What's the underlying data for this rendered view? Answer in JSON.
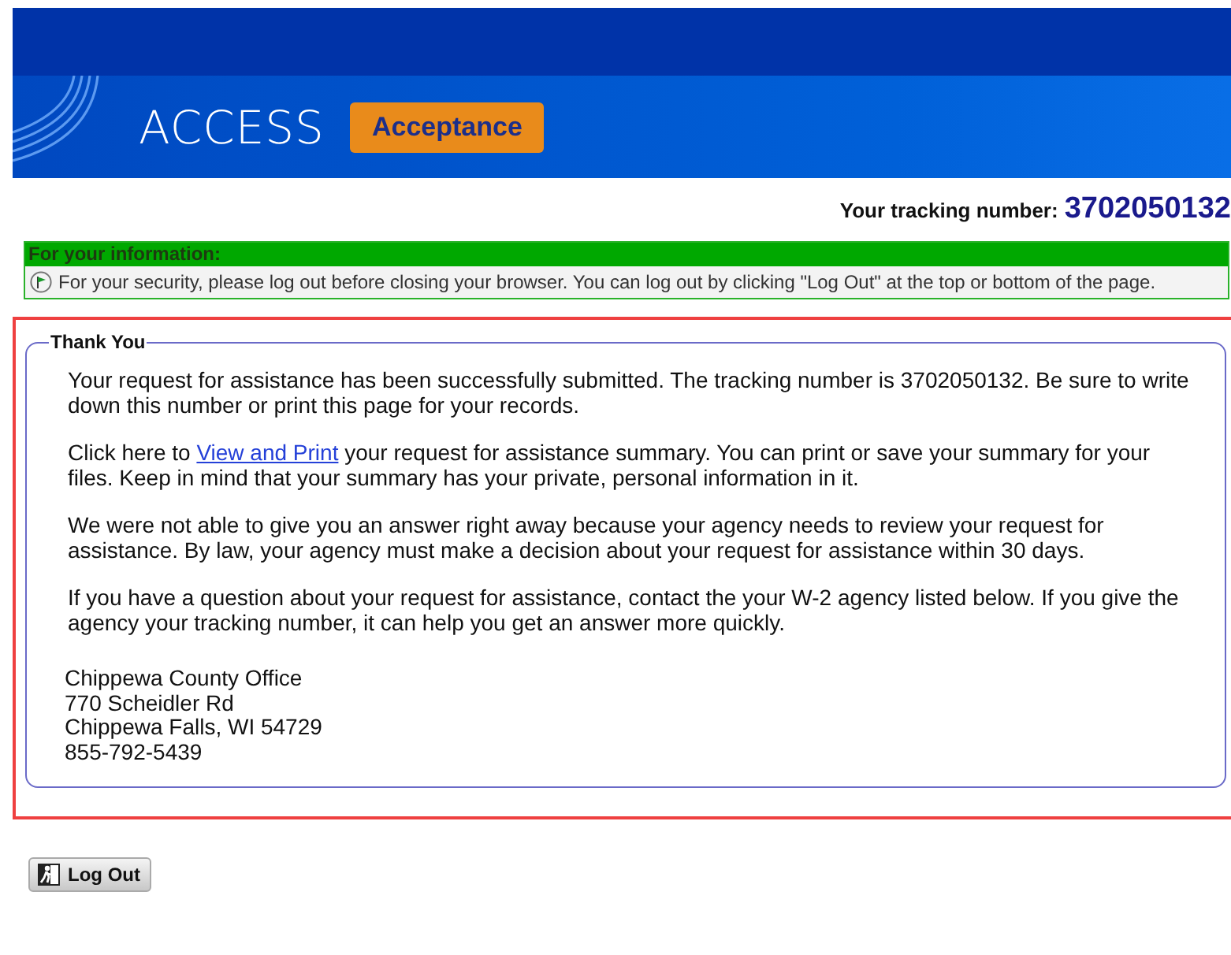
{
  "header": {
    "logo": "ACCESS",
    "badge": "Acceptance"
  },
  "tracking": {
    "label": "Your tracking number:",
    "number": "3702050132"
  },
  "info": {
    "title": "For your information:",
    "message": "For your security, please log out before closing your browser. You can log out by clicking \"Log Out\" at the top or bottom of the page."
  },
  "panel": {
    "legend": "Thank You",
    "paragraphs": [
      {
        "kind": "text",
        "text": "Your request for assistance has been successfully submitted. The tracking number is 3702050132. Be sure to write down this number or print this page for your records."
      },
      {
        "kind": "link",
        "before": "Click here to ",
        "link": "View and Print",
        "after": " your request for assistance summary. You can print or save your summary for your files. Keep in mind that your summary has your private, personal information in it."
      },
      {
        "kind": "text",
        "text": "We were not able to give you an answer right away because your agency needs to review your request for assistance. By law, your agency must make a decision about your request for assistance within 30 days."
      },
      {
        "kind": "text",
        "text": "If you have a question about your request for assistance, contact the your W-2 agency listed below. If you give the agency your tracking number, it can help you get an answer more quickly."
      }
    ],
    "address": [
      "Chippewa County Office",
      "770 Scheidler Rd",
      "Chippewa Falls, WI 54729",
      "855-792-5439"
    ]
  },
  "logout": {
    "label": "Log Out"
  }
}
